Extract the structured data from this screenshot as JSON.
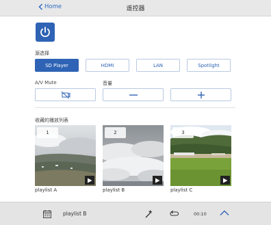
{
  "header": {
    "back_label": "Home",
    "title": "遥控器"
  },
  "source": {
    "label": "源选择",
    "options": [
      "SD Player",
      "HDMI",
      "LAN",
      "Spotlight"
    ],
    "selected": "SD Player"
  },
  "controls": {
    "av_mute_label": "A/V Mute",
    "volume_label": "音量",
    "volume_down": "—",
    "volume_up": "+"
  },
  "favorites": {
    "label": "收藏的播放列表",
    "items": [
      {
        "number": "1",
        "name": "playlist A"
      },
      {
        "number": "2",
        "name": "playlist B"
      },
      {
        "number": "3",
        "name": "playlist C"
      }
    ]
  },
  "player": {
    "current_playlist": "playlist B",
    "time": "00:10"
  },
  "colors": {
    "accent": "#2e63b5",
    "header_bg": "#e8e8e8",
    "footer_bg": "#e4e4e4"
  },
  "icons": {
    "power": "power-icon",
    "av_mute": "av-mute-icon",
    "playlist": "playlist-icon",
    "effect": "magic-wand-icon",
    "repeat": "repeat-icon",
    "expand": "chevron-up-icon"
  }
}
